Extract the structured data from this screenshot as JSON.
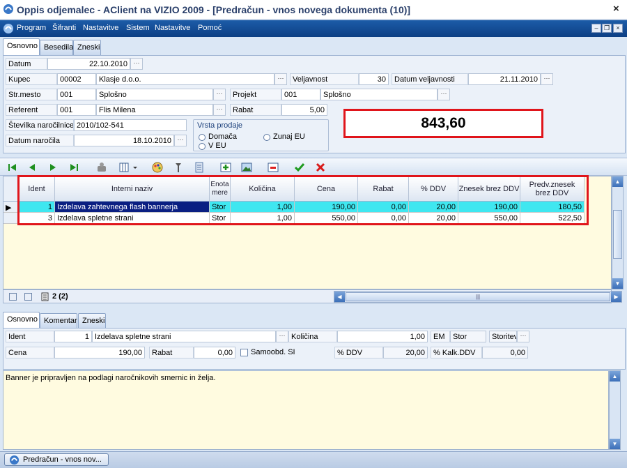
{
  "window": {
    "title": "Oppis odjemalec - AClient na VIZIO 2009 - [Predračun - vnos novega dokumenta (10)]",
    "close": "×"
  },
  "menu": [
    "Program",
    "Šifranti",
    "Nastavitve",
    "Sistem",
    "Nastavitve",
    "Pomoć"
  ],
  "mdi": {
    "min": "–",
    "restore": "❐",
    "close": "×"
  },
  "tabs_top": [
    "Osnovno",
    "Besedila",
    "Zneski"
  ],
  "form": {
    "datum_label": "Datum",
    "datum": "22.10.2010",
    "kupec_label": "Kupec",
    "kupec_code": "00002",
    "kupec_name": "Klasje d.o.o.",
    "veljavnost_label": "Veljavnost",
    "veljavnost": "30",
    "datum_veljavnosti_label": "Datum veljavnosti",
    "datum_veljavnosti": "21.11.2010",
    "strmesto_label": "Str.mesto",
    "strmesto_code": "001",
    "strmesto_name": "Splošno",
    "projekt_label": "Projekt",
    "projekt_code": "001",
    "projekt_name": "Splošno",
    "referent_label": "Referent",
    "referent_code": "001",
    "referent_name": "Flis Milena",
    "rabat_label": "Rabat",
    "rabat": "5,00",
    "narocilnica_label": "Številka naročilnice",
    "narocilnica": "2010/102-541",
    "datum_narocila_label": "Datum naročila",
    "datum_narocila": "18.10.2010",
    "vrsta_label": "Vrsta prodaje",
    "vrsta_domaca": "Domača",
    "vrsta_zunaj": "Zunaj EU",
    "vrsta_veu": "V EU",
    "total": "843,60",
    "dots": "···"
  },
  "toolbar_icons": [
    "first-icon",
    "prev-icon",
    "next-icon",
    "last-icon",
    "copy-icon",
    "columns-icon",
    "dropdown-icon",
    "palette-icon",
    "tools-icon",
    "document-icon",
    "add-row-icon",
    "image-icon",
    "delete-row-icon",
    "confirm-icon",
    "cancel-icon"
  ],
  "grid": {
    "columns": [
      "Ident",
      "Interni naziv",
      "Enota mere",
      "Količina",
      "Cena",
      "Rabat",
      "% DDV",
      "Znesek brez DDV",
      "Predv.znesek brez DDV"
    ],
    "rows": [
      [
        "1",
        "Izdelava zahtevnega flash bannerja",
        "Stor",
        "1,00",
        "190,00",
        "0,00",
        "20,00",
        "190,00",
        "180,50"
      ],
      [
        "3",
        "Izdelava spletne strani",
        "Stor",
        "1,00",
        "550,00",
        "0,00",
        "20,00",
        "550,00",
        "522,50"
      ]
    ],
    "count": "2 (2)"
  },
  "tabs_bottom": [
    "Osnovno",
    "Komentar",
    "Zneski"
  ],
  "detail": {
    "ident_label": "Ident",
    "ident": "1",
    "naziv": "Izdelava spletne strani",
    "kolicina_label": "Količina",
    "kolicina": "1,00",
    "em_label": "EM",
    "em": "Stor",
    "storitev": "Storitev",
    "cena_label": "Cena",
    "cena": "190,00",
    "rabat_label": "Rabat",
    "rabat": "0,00",
    "samoobd_label": "Samoobd. SI",
    "ddv_label": "% DDV",
    "ddv": "20,00",
    "kalk_label": "% Kalk.DDV",
    "kalk": "0,00"
  },
  "memo": "Banner je pripravljen na podlagi naročnikovih smernic in želja.",
  "taskbar": {
    "button": "Predračun - vnos nov..."
  }
}
